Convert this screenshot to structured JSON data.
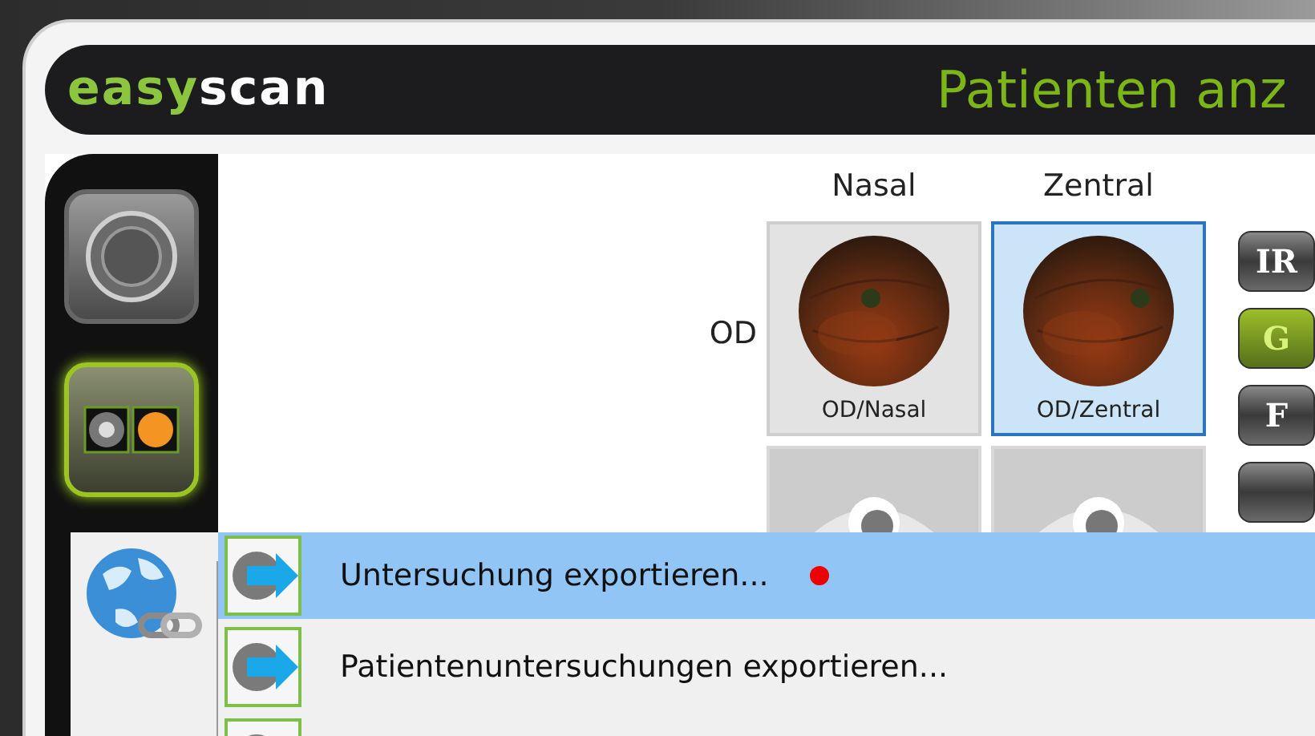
{
  "header": {
    "logo": [
      {
        "text": "easy",
        "kind": "accent"
      },
      {
        "text": "scan",
        "kind": "plain"
      }
    ],
    "title": "Patienten anz"
  },
  "sidebar": {
    "items": [
      {
        "kind": "camera",
        "selected": false
      },
      {
        "kind": "lights",
        "selected": true
      }
    ]
  },
  "grid": {
    "columns": [
      "Nasal",
      "Zentral"
    ],
    "rows": [
      {
        "label": "OD",
        "cells": [
          {
            "caption": "OD/Nasal",
            "selected": false
          },
          {
            "caption": "OD/Zentral",
            "selected": true
          }
        ]
      },
      {
        "cells": [
          {
            "kind": "empty",
            "selected": false
          },
          {
            "kind": "empty",
            "selected": false
          }
        ]
      }
    ]
  },
  "channels": [
    {
      "label": "IR",
      "selected": false
    },
    {
      "label": "G",
      "selected": true
    },
    {
      "label": "F",
      "selected": false
    },
    {
      "selected": false
    }
  ],
  "menu": {
    "items": [
      {
        "label": "Untersuchung exportieren...",
        "selected": true,
        "marked": true
      },
      {
        "label": "Patientenuntersuchungen exportieren...",
        "selected": false,
        "marked": false
      },
      {
        "selected": false
      }
    ]
  }
}
